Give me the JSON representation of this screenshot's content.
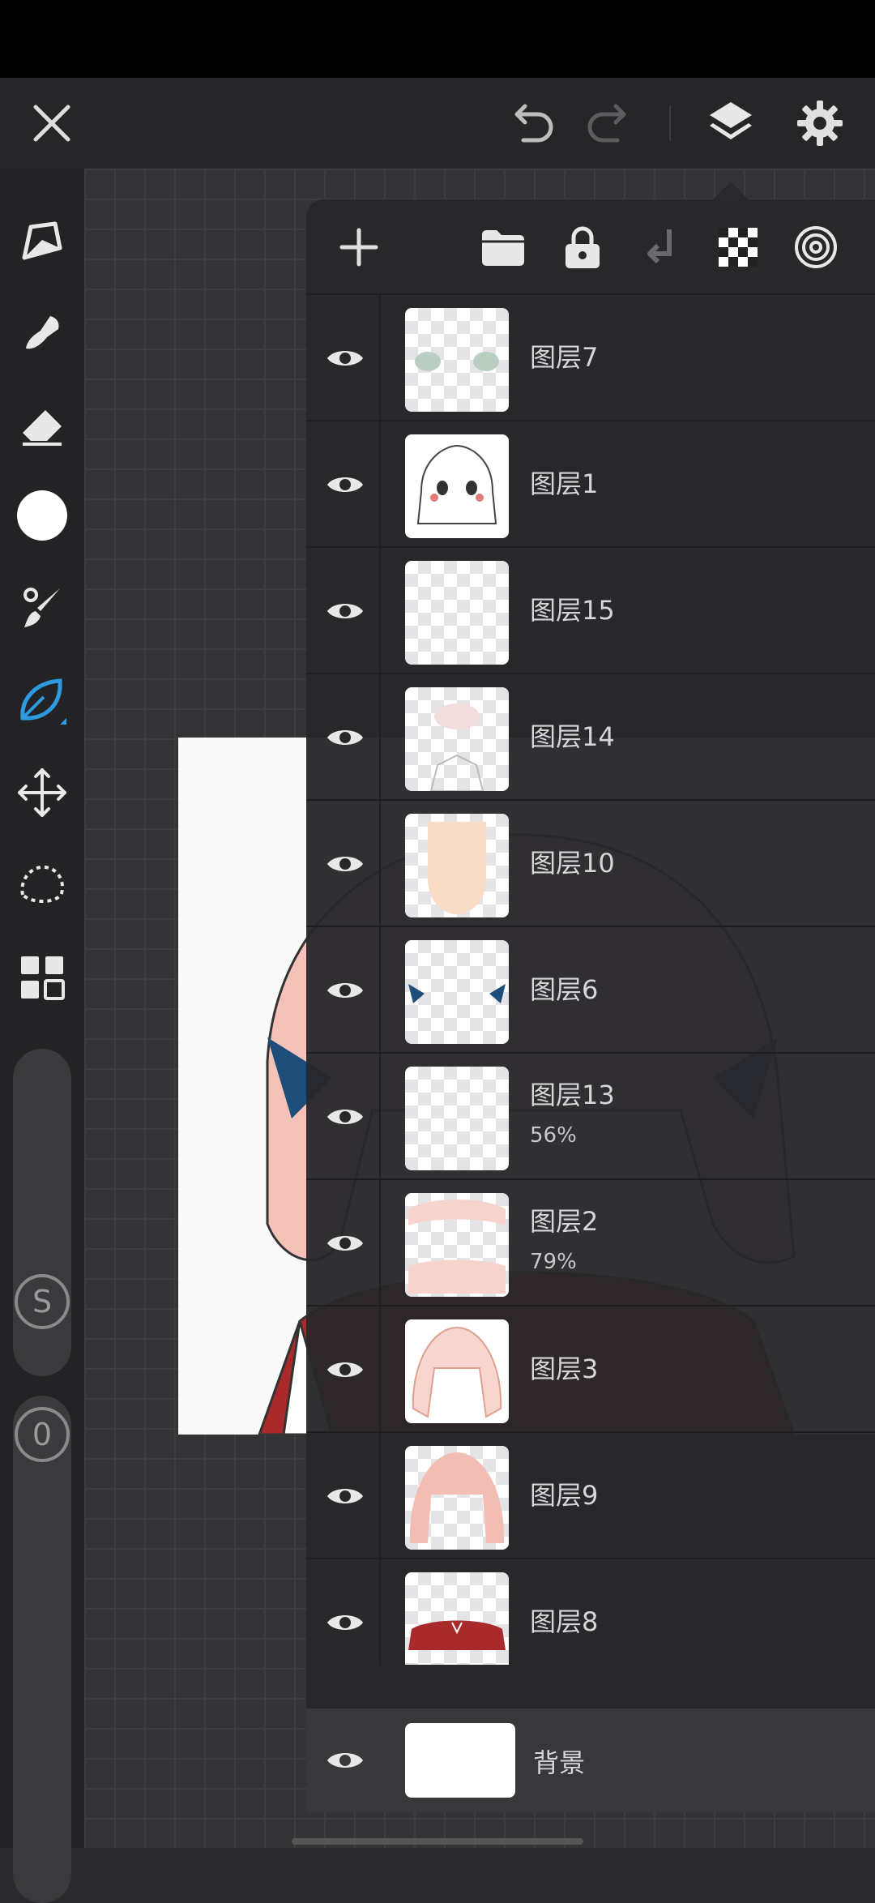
{
  "toolbar": {
    "close_icon": "close-icon",
    "undo_icon": "undo-icon",
    "redo_icon": "redo-icon",
    "layers_icon": "layers-icon",
    "settings_icon": "gear-icon"
  },
  "tools": [
    "pen-icon",
    "smudge-icon",
    "eraser-icon",
    "color-icon",
    "brush-icon",
    "leaf-brush-icon",
    "transform-icon",
    "lasso-icon",
    "grid-icon"
  ],
  "sliders": {
    "size_label": "S",
    "opacity_label": "0"
  },
  "layers_panel": {
    "toolbar_icons": [
      "add-icon",
      "folder-icon",
      "lock-icon",
      "merge-down-icon",
      "transparency-icon",
      "target-icon"
    ],
    "layers": [
      {
        "name": "图层7",
        "opacity": ""
      },
      {
        "name": "图层1",
        "opacity": ""
      },
      {
        "name": "图层15",
        "opacity": ""
      },
      {
        "name": "图层14",
        "opacity": ""
      },
      {
        "name": "图层10",
        "opacity": ""
      },
      {
        "name": "图层6",
        "opacity": ""
      },
      {
        "name": "图层13",
        "opacity": "56%"
      },
      {
        "name": "图层2",
        "opacity": "79%"
      },
      {
        "name": "图层3",
        "opacity": ""
      },
      {
        "name": "图层9",
        "opacity": ""
      },
      {
        "name": "图层8",
        "opacity": ""
      }
    ],
    "background_layer": {
      "name": "背景"
    }
  },
  "colors": {
    "accent": "#2e9be0",
    "hair": "#f4c2b8",
    "outfit": "#a82a2a",
    "ribbon": "#1f4d7a"
  }
}
